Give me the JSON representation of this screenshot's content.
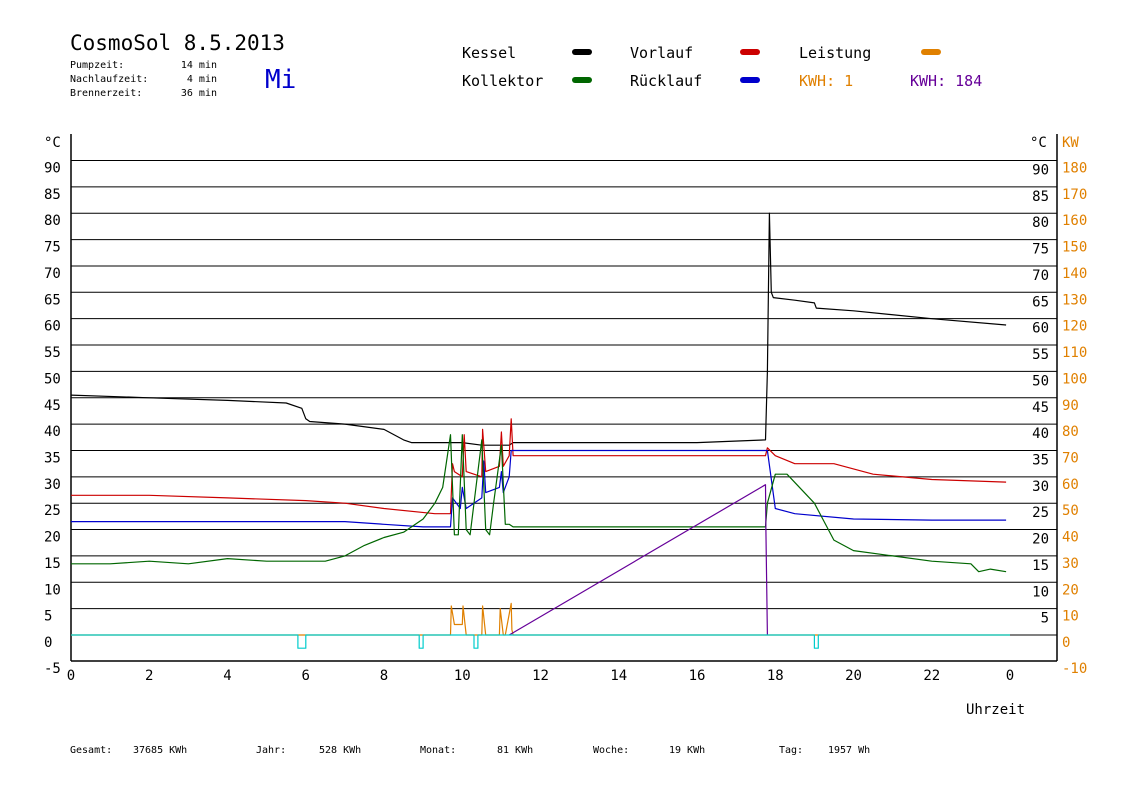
{
  "header": {
    "title": "CosmoSol 8.5.2013",
    "day": "Mi",
    "stats": [
      {
        "label": "Pumpzeit:",
        "value": "14 min"
      },
      {
        "label": "Nachlaufzeit:",
        "value": "4 min"
      },
      {
        "label": "Brennerzeit:",
        "value": "36 min"
      }
    ]
  },
  "legend": {
    "kessel": "Kessel",
    "kollektor": "Kollektor",
    "vorlauf": "Vorlauf",
    "ruecklauf": "Rücklauf",
    "leistung": "Leistung",
    "kwh1": "KWH: 1",
    "kwh2": "KWH: 184"
  },
  "footer": [
    {
      "label": "Gesamt:",
      "value": "37685 KWh"
    },
    {
      "label": "Jahr:",
      "value": "528 KWh"
    },
    {
      "label": "Monat:",
      "value": "81 KWh"
    },
    {
      "label": "Woche:",
      "value": "19 KWh"
    },
    {
      "label": "Tag:",
      "value": "1957 Wh"
    }
  ],
  "colors": {
    "kessel": "#000000",
    "vorlauf": "#cc0000",
    "ruecklauf": "#0000cc",
    "kollektor": "#006600",
    "leistung": "#e08000",
    "kwh": "#660099",
    "pumpe": "#00cccc",
    "kw_axis": "#e08000"
  },
  "chart_data": {
    "type": "line",
    "xlabel": "Uhrzeit",
    "ylabel_left": "°C",
    "ylabel_right_temp": "°C",
    "ylabel_right_kw": "KW",
    "xlim": [
      0,
      24
    ],
    "ylim": [
      -5,
      95
    ],
    "xticks": [
      0,
      2,
      4,
      6,
      8,
      10,
      12,
      14,
      16,
      18,
      20,
      22,
      24
    ],
    "xtick_labels": [
      "0",
      "2",
      "4",
      "6",
      "8",
      "10",
      "12",
      "14",
      "16",
      "18",
      "20",
      "22",
      "0"
    ],
    "yticks_left": [
      -5,
      0,
      5,
      10,
      15,
      20,
      25,
      30,
      35,
      40,
      45,
      50,
      55,
      60,
      65,
      70,
      75,
      80,
      85,
      90
    ],
    "yticks_right_temp": [
      5,
      10,
      15,
      20,
      25,
      30,
      35,
      40,
      45,
      50,
      55,
      60,
      65,
      70,
      75,
      80,
      85,
      90
    ],
    "yticks_right_kw": [
      -10,
      0,
      10,
      20,
      30,
      40,
      50,
      60,
      70,
      80,
      90,
      100,
      110,
      120,
      130,
      140,
      150,
      160,
      170,
      180
    ],
    "grid": true,
    "series": [
      {
        "name": "Kessel",
        "color_key": "kessel",
        "x": [
          0,
          2,
          4,
          5.5,
          5.9,
          6.0,
          6.1,
          7.0,
          8.0,
          8.5,
          8.7,
          10.0,
          10.5,
          11.2,
          11.3,
          16.0,
          17.75,
          17.8,
          17.85,
          17.9,
          17.95,
          18.5,
          19.0,
          19.05,
          20.0,
          22.0,
          23.9
        ],
        "y": [
          45.5,
          45,
          44.5,
          44,
          43,
          41,
          40.5,
          40,
          39,
          37,
          36.5,
          36.5,
          36,
          36,
          36.5,
          36.5,
          37,
          50,
          80,
          65,
          64,
          63.5,
          63,
          62,
          61.5,
          60,
          58.8
        ]
      },
      {
        "name": "Vorlauf",
        "color_key": "vorlauf",
        "x": [
          0,
          2,
          4,
          6,
          7,
          8,
          9.3,
          9.7,
          9.75,
          9.8,
          10.0,
          10.05,
          10.1,
          10.5,
          10.52,
          10.6,
          10.95,
          11.0,
          11.05,
          11.2,
          11.25,
          11.3,
          17.75,
          17.8,
          18.0,
          18.5,
          19.5,
          20.5,
          22.0,
          23.9
        ],
        "y": [
          26.5,
          26.5,
          26,
          25.5,
          25,
          24,
          23,
          23,
          32.5,
          31,
          30,
          38,
          31,
          30,
          39,
          31,
          32,
          38.5,
          32,
          34,
          41,
          34,
          34,
          35.5,
          34,
          32.5,
          32.5,
          30.5,
          29.5,
          29
        ]
      },
      {
        "name": "Rücklauf",
        "color_key": "ruecklauf",
        "x": [
          0,
          2,
          4,
          6,
          7,
          8,
          9.0,
          9.7,
          9.75,
          9.95,
          10.0,
          10.1,
          10.5,
          10.55,
          10.6,
          10.95,
          11.0,
          11.05,
          11.2,
          11.25,
          11.3,
          17.75,
          17.8,
          18.0,
          18.5,
          20.0,
          22.0,
          23.9
        ],
        "y": [
          21.5,
          21.5,
          21.5,
          21.5,
          21.5,
          21,
          20.5,
          20.5,
          26,
          24,
          28,
          24,
          26,
          33,
          27,
          28,
          31,
          27,
          30,
          35,
          35,
          35,
          35,
          24,
          23,
          22,
          21.8,
          21.8
        ]
      },
      {
        "name": "Kollektor",
        "color_key": "kollektor",
        "x": [
          0,
          1,
          2,
          3,
          4,
          5,
          6,
          6.5,
          7.0,
          7.5,
          8.0,
          8.5,
          9.0,
          9.3,
          9.5,
          9.7,
          9.8,
          9.9,
          10.0,
          10.1,
          10.2,
          10.3,
          10.5,
          10.6,
          10.7,
          10.8,
          11.0,
          11.1,
          11.2,
          11.3,
          17.75,
          17.8,
          18.0,
          18.3,
          19.0,
          19.5,
          20.0,
          21.0,
          22.0,
          23.0,
          23.2,
          23.5,
          23.9
        ],
        "y": [
          13.5,
          13.5,
          14,
          13.5,
          14.5,
          14,
          14,
          14,
          15,
          17,
          18.5,
          19.5,
          22,
          25,
          28,
          38,
          19,
          19,
          38,
          20,
          19,
          25,
          37,
          20,
          19,
          25,
          36,
          21,
          21,
          20.5,
          20.5,
          25,
          30.5,
          30.5,
          25,
          18,
          16,
          15,
          14,
          13.5,
          12,
          12.5,
          12
        ]
      },
      {
        "name": "Leistung",
        "color_key": "leistung",
        "x": [
          0,
          9.7,
          9.72,
          9.8,
          10.0,
          10.02,
          10.1,
          10.5,
          10.52,
          10.6,
          10.95,
          10.97,
          11.05,
          11.1,
          11.25,
          11.27,
          11.3,
          24
        ],
        "y": [
          0,
          0,
          5.5,
          2,
          2,
          5.5,
          0,
          0,
          5.5,
          0,
          0,
          5,
          0,
          0,
          6,
          1,
          0,
          0
        ]
      },
      {
        "name": "KWH",
        "color_key": "kwh",
        "x": [
          11.2,
          17.75,
          17.76,
          17.8
        ],
        "y": [
          0,
          28.5,
          20,
          0
        ]
      },
      {
        "name": "Pumpe",
        "color_key": "pumpe",
        "x": [
          0,
          5.8,
          5.8,
          6.0,
          6.0,
          8.9,
          8.9,
          9.0,
          9.0,
          10.3,
          10.3,
          10.4,
          10.4,
          19.0,
          19.0,
          19.1,
          19.1,
          24
        ],
        "y": [
          0,
          0,
          -2.5,
          -2.5,
          0,
          0,
          -2.5,
          -2.5,
          0,
          0,
          -2.5,
          -2.5,
          0,
          0,
          -2.5,
          -2.5,
          0,
          0
        ]
      }
    ]
  }
}
